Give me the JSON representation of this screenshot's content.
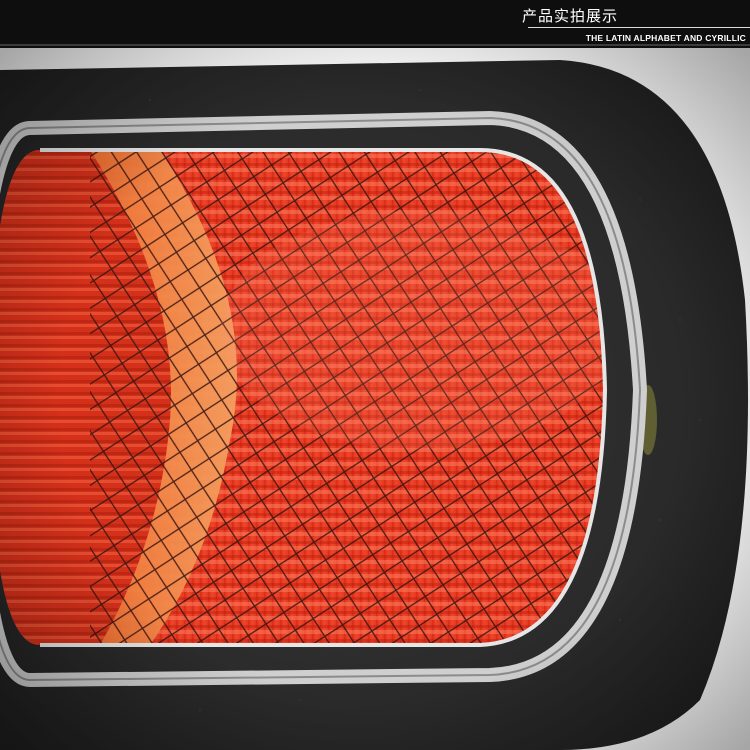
{
  "header": {
    "title": "产品实拍展示",
    "subtitle": "THE LATIN ALPHABET AND CYRILLIC"
  },
  "photo": {
    "subject": "air-filter-closeup",
    "colors": {
      "foam": "#2a2a2a",
      "filter_red": "#e8381e",
      "filter_orange": "#f07020",
      "frame_silver": "#cfcfcf",
      "mesh": "#3a1410",
      "background": "#ffffff"
    }
  }
}
